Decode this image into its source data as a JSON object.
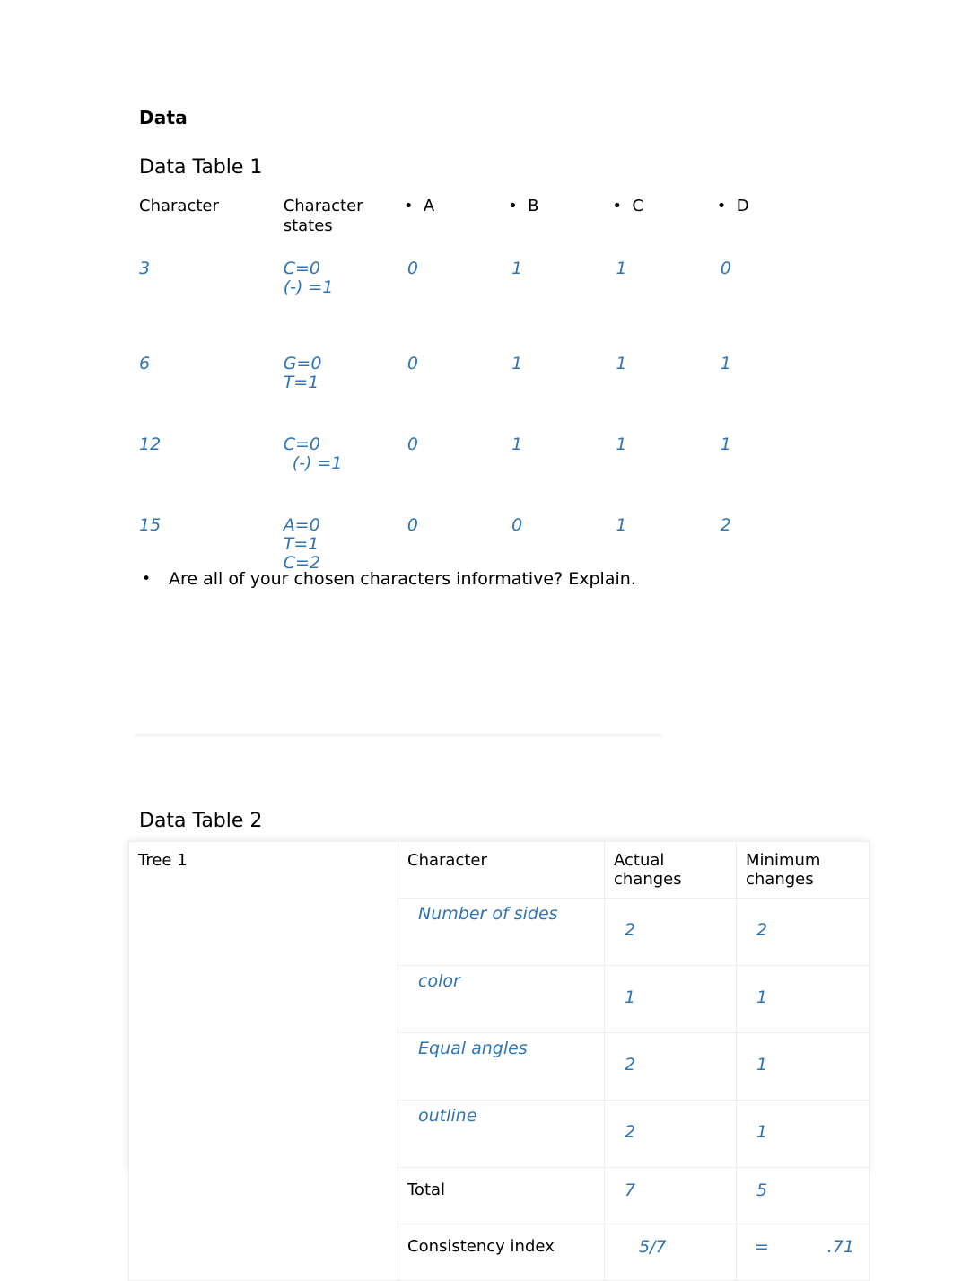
{
  "document": {
    "heading": "Data",
    "table1_title": "Data Table 1",
    "table2_title": "Data Table 2",
    "question_bullet": "•",
    "question_text": "Are all of your chosen characters informative? Explain.",
    "accent_color": "#2E74B5",
    "text_color": "#000000"
  },
  "table1": {
    "headers": {
      "character": "Character",
      "character_states": "Character\nstates",
      "a": "A",
      "b": "B",
      "c": "C",
      "d": "D",
      "bullet": "•"
    },
    "rows": [
      {
        "character": "3",
        "states": [
          "C=0",
          "(-) =1"
        ],
        "states_indent": [
          false,
          false
        ],
        "a": "0",
        "b": "1",
        "c": "1",
        "d": "0"
      },
      {
        "character": "6",
        "states": [
          "G=0",
          "T=1"
        ],
        "states_indent": [
          false,
          false
        ],
        "a": "0",
        "b": "1",
        "c": "1",
        "d": "1"
      },
      {
        "character": "12",
        "states": [
          "C=0",
          "(-) =1"
        ],
        "states_indent": [
          false,
          true
        ],
        "a": "0",
        "b": "1",
        "c": "1",
        "d": "1"
      },
      {
        "character": "15",
        "states": [
          "A=0",
          "T=1",
          "C=2"
        ],
        "states_indent": [
          false,
          false,
          false
        ],
        "a": "0",
        "b": "0",
        "c": "1",
        "d": "2"
      }
    ]
  },
  "table2": {
    "headers": {
      "tree": "Tree 1",
      "character": "Character",
      "actual_changes": "Actual changes",
      "minimum_changes": "Minimum changes"
    },
    "rows": [
      {
        "character": "Number of sides",
        "actual": "2",
        "minimum": "2"
      },
      {
        "character": "color",
        "actual": "1",
        "minimum": "1"
      },
      {
        "character": "Equal angles",
        "actual": "2",
        "minimum": "1"
      },
      {
        "character": "outline",
        "actual": "2",
        "minimum": "1"
      }
    ],
    "total": {
      "label": "Total",
      "actual": "7",
      "minimum": "5"
    },
    "consistency_index": {
      "label": "Consistency index",
      "fraction": "5/7",
      "equals": "=",
      "value": ".71"
    }
  }
}
